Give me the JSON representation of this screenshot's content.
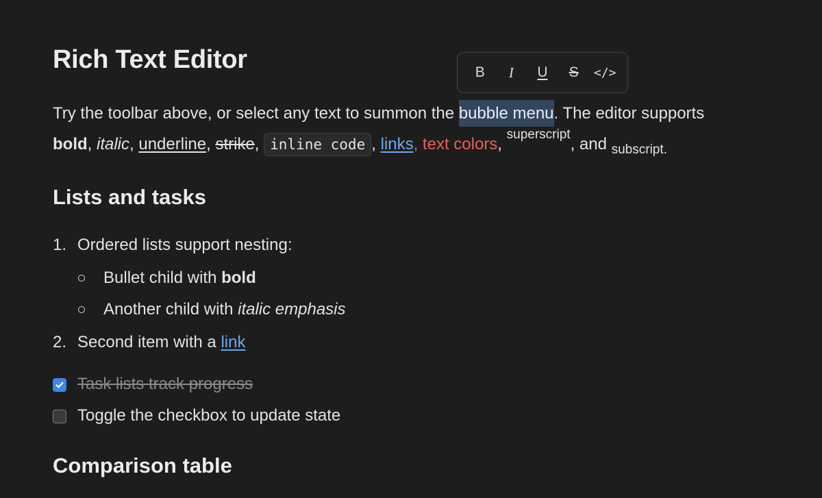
{
  "heading": "Rich Text Editor",
  "bubble_menu": {
    "buttons": [
      {
        "name": "bold",
        "label": "B"
      },
      {
        "name": "italic",
        "label": "I"
      },
      {
        "name": "underline",
        "label": "U"
      },
      {
        "name": "strike",
        "label": "S"
      },
      {
        "name": "code",
        "label": "</>"
      }
    ]
  },
  "intro": {
    "t1": "Try the toolbar above, or select any text to summon the ",
    "selected": "bubble menu",
    "t2": ". The editor supports ",
    "bold": "bold",
    "comma1": ", ",
    "italic": "italic",
    "comma2": ", ",
    "underline": "underline",
    "comma3": ", ",
    "strike": "strike",
    "comma4": ", ",
    "code": "inline code",
    "comma5": ", ",
    "link": "links",
    "comma6": ", ",
    "colored": "text colors",
    "comma7": ", ",
    "superscript": "superscript",
    "and": ", and ",
    "subscript": "subscript",
    "period": "."
  },
  "lists_heading": "Lists and tasks",
  "ordered": [
    {
      "marker": "1.",
      "text": "Ordered lists support nesting:"
    },
    {
      "marker": "2.",
      "text": "Second item with a ",
      "link": "link"
    }
  ],
  "bullets": [
    {
      "text": "Bullet child with ",
      "emph": "bold"
    },
    {
      "text": "Another child with ",
      "emph": "italic emphasis"
    }
  ],
  "tasks": [
    {
      "text": "Task lists track progress",
      "checked": true
    },
    {
      "text": "Toggle the checkbox to update state",
      "checked": false
    }
  ],
  "table_heading": "Comparison table",
  "colors": {
    "background": "#1d1d1d",
    "link": "#6fa7f0",
    "red_text": "#e5605b",
    "checkbox_checked": "#3f86e8",
    "selection": "#34465e"
  }
}
